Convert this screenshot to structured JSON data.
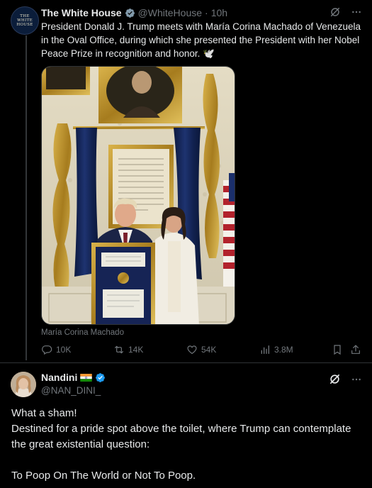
{
  "tweet": {
    "author_name": "The White House",
    "author_handle": "@WhiteHouse",
    "separator": "·",
    "time": "10h",
    "avatar_text_1": "THE",
    "avatar_text_2": "WHITE",
    "avatar_text_3": "HOUSE",
    "text": "President Donald J. Trump meets with María Corina Machado of Venezuela in the Oval Office, during which she presented the President with her Nobel Peace Prize in recognition and honor. 🕊️",
    "photo_caption": "María Corina Machado",
    "stats": {
      "replies": "10K",
      "reposts": "14K",
      "likes": "54K",
      "views": "3.8M"
    },
    "icons": [
      "grok-icon",
      "more-icon",
      "reply-icon",
      "repost-icon",
      "like-icon",
      "views-icon",
      "bookmark-icon",
      "share-icon"
    ]
  },
  "reply": {
    "author_name": "Nandini",
    "author_handle": "@NAN_DINI_",
    "line1": "What a sham!",
    "line2": "Destined for a pride spot above the toilet, where Trump can contemplate the great existential question:",
    "line3": "To Poop On The World or Not To Poop."
  },
  "colors": {
    "background": "#000000",
    "text": "#e7e9ea",
    "muted": "#71767b",
    "verified_blue": "#1d9bf0",
    "verified_gray": "#829aab"
  }
}
